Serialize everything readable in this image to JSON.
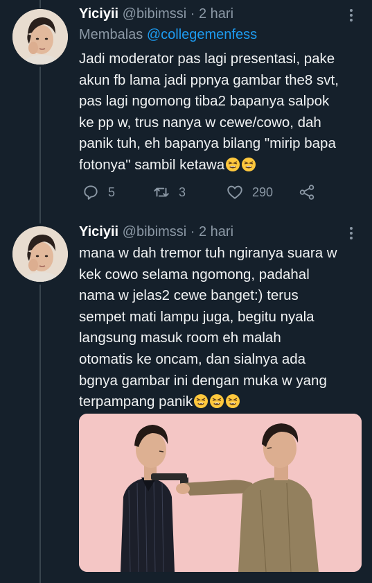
{
  "tweets": [
    {
      "display_name": "Yiciyii",
      "handle": "@bibimssi",
      "separator": "·",
      "time": "2 hari",
      "replying_prefix": "Membalas",
      "replying_to": "@collegemenfess",
      "lines": [
        "Jadi moderator pas lagi presentasi, pake",
        "akun fb lama jadi ppnya gambar the8 svt,",
        "pas lagi ngomong tiba2 bapanya salpok",
        "ke pp w, trus nanya w cewe/cowo, dah",
        "panik tuh, eh bapanya bilang \"mirip bapa",
        "fotonya\" sambil ketawa"
      ],
      "emoji_count": 2,
      "reply_count": "5",
      "retweet_count": "3",
      "like_count": "290"
    },
    {
      "display_name": "Yiciyii",
      "handle": "@bibimssi",
      "separator": "·",
      "time": "2 hari",
      "lines": [
        "mana w dah tremor tuh ngiranya suara w",
        "kek cowo selama ngomong, padahal",
        "nama w jelas2 cewe banget:) terus",
        "sempet mati lampu juga, begitu nyala",
        "langsung masuk room eh malah",
        "otomatis ke oncam, dan sialnya ada",
        "bgnya gambar ini dengan muka w yang",
        "terpampang panik"
      ],
      "emoji_count": 3,
      "media": "photo"
    }
  ],
  "icons": {
    "reply": "speech-bubble-icon",
    "retweet": "retweet-arrows-icon",
    "like": "heart-icon",
    "share": "share-nodes-icon",
    "more": "vertical-dots-icon",
    "emoji": "tired-face-emoji"
  },
  "colors": {
    "background": "#15202b",
    "primary_text": "#e7e9ea",
    "secondary_text": "#8b98a5",
    "mention": "#1d9bf0",
    "thread_line": "#38444d",
    "media_background": "#f4c6c5"
  }
}
